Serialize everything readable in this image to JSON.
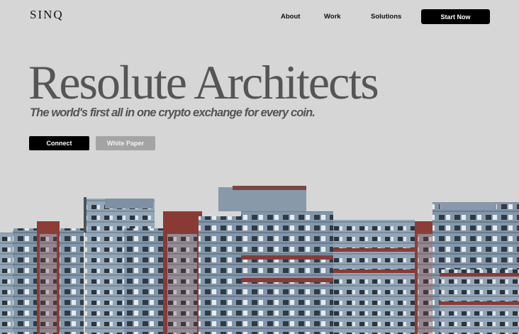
{
  "brand": {
    "logo": "SINQ"
  },
  "nav": {
    "items": [
      "About",
      "Work",
      "Solutions"
    ],
    "cta": "Start Now"
  },
  "hero": {
    "title": "Resolute Architects",
    "subtitle": "The world's first all in one crypto exchange for every coin.",
    "primary_button": "Connect",
    "secondary_button": "White Paper"
  },
  "colors": {
    "background": "#d6d6d6",
    "button_primary": "#000000",
    "button_secondary": "#a4a4a4",
    "building_blue": "#7a8ea0",
    "building_red": "#8a3a35"
  }
}
